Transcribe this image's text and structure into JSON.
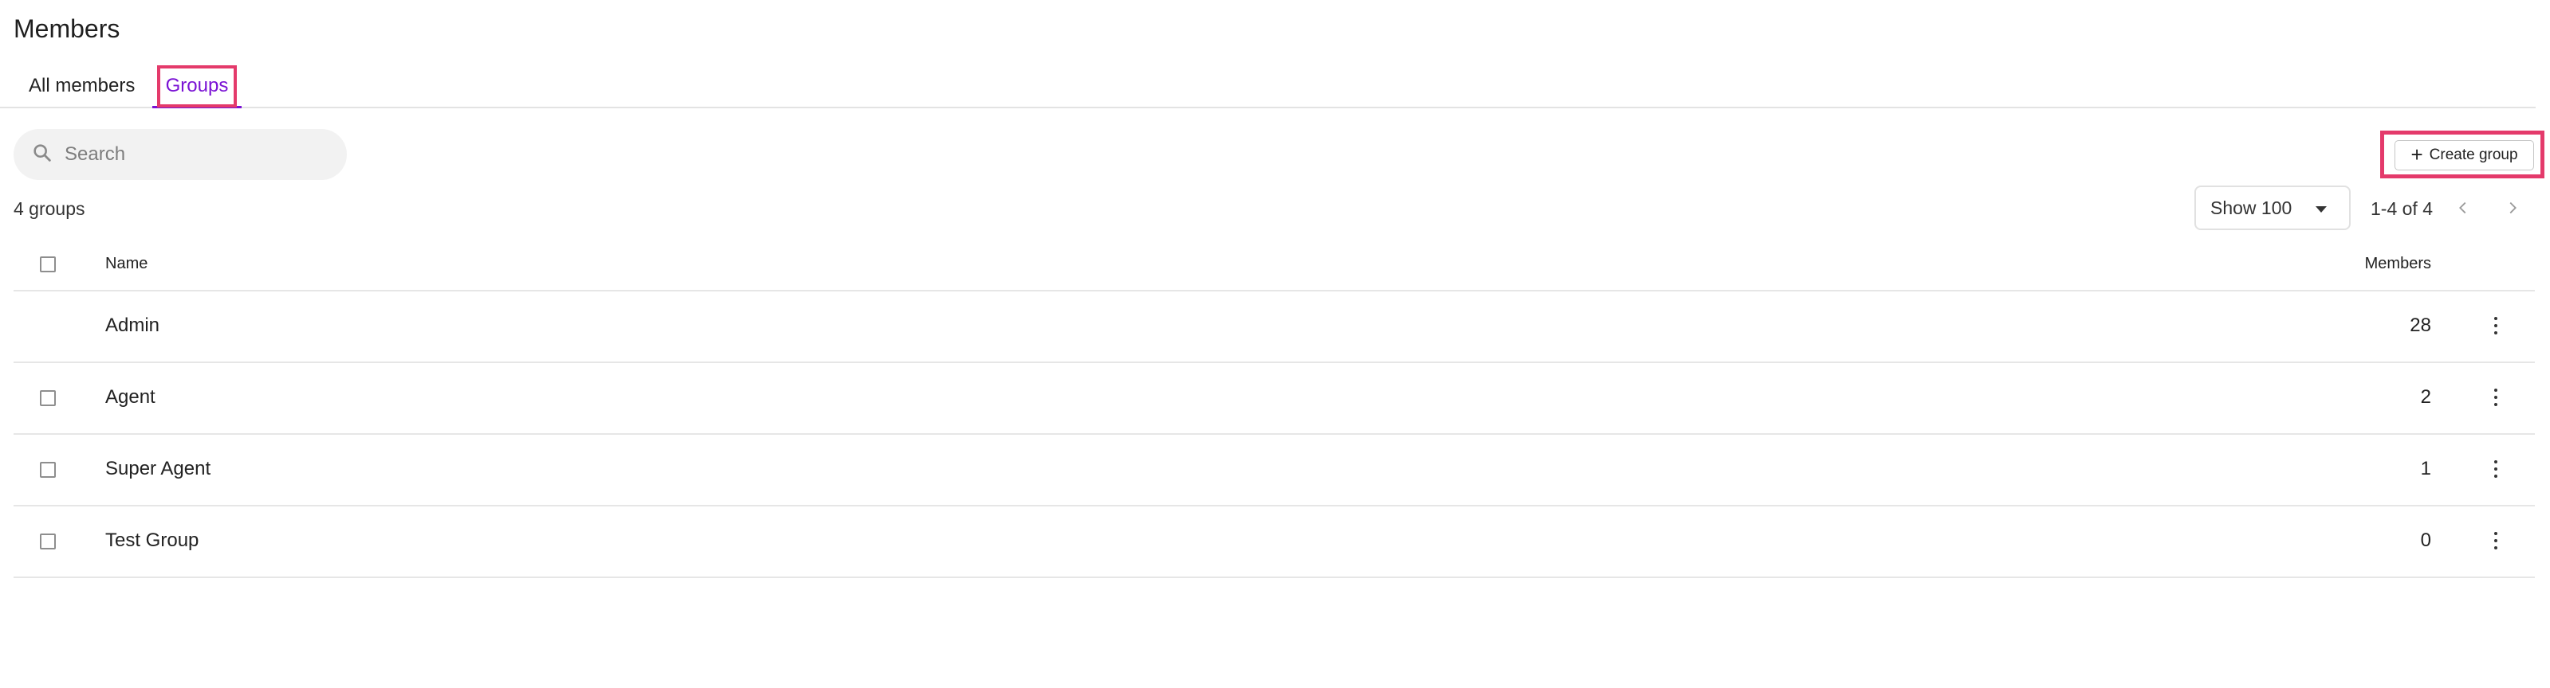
{
  "page": {
    "title": "Members"
  },
  "tabs": [
    {
      "label": "All members",
      "active": false
    },
    {
      "label": "Groups",
      "active": true
    }
  ],
  "search": {
    "placeholder": "Search",
    "value": ""
  },
  "toolbar": {
    "create_label": "Create group"
  },
  "summary": {
    "count_text": "4 groups",
    "page_size_label": "Show 100",
    "range_text": "1-4 of 4"
  },
  "table": {
    "columns": {
      "name": "Name",
      "members": "Members"
    },
    "rows": [
      {
        "name": "Admin",
        "members": "28",
        "selectable": false
      },
      {
        "name": "Agent",
        "members": "2",
        "selectable": true
      },
      {
        "name": "Super Agent",
        "members": "1",
        "selectable": true
      },
      {
        "name": "Test Group",
        "members": "0",
        "selectable": true
      }
    ]
  },
  "colors": {
    "accent": "#7a12d4",
    "highlight": "#e43a6b"
  },
  "icons": {
    "search": "search-icon",
    "create": "plus-icon",
    "dropdown": "caret-down-icon",
    "prev": "chevron-left-icon",
    "next": "chevron-right-icon",
    "row_menu": "more-vertical-icon"
  }
}
